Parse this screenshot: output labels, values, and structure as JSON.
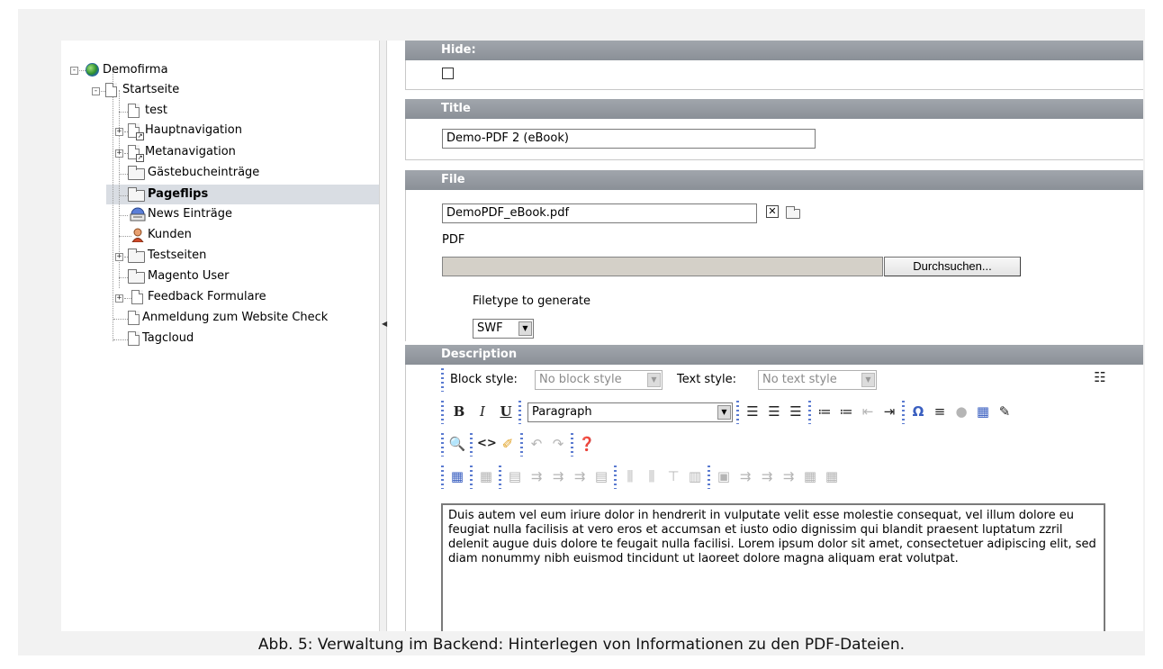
{
  "tree": {
    "root": "Demofirma",
    "items": [
      {
        "label": "Startseite"
      },
      {
        "label": "test"
      },
      {
        "label": "Hauptnavigation"
      },
      {
        "label": "Metanavigation"
      },
      {
        "label": "Gästebucheinträge"
      },
      {
        "label": "Pageflips"
      },
      {
        "label": "News Einträge"
      },
      {
        "label": "Kunden"
      },
      {
        "label": "Testseiten"
      },
      {
        "label": "Magento User"
      },
      {
        "label": "Feedback Formulare"
      },
      {
        "label": "Anmeldung zum Website Check"
      },
      {
        "label": "Tagcloud"
      }
    ],
    "expand_symbol": "+",
    "collapse_symbol": "-"
  },
  "form": {
    "hide": {
      "label": "Hide:",
      "checked": false
    },
    "title": {
      "label": "Title",
      "value": "Demo-PDF 2 (eBook)"
    },
    "file": {
      "label": "File",
      "value": "DemoPDF_eBook.pdf",
      "pdf_label": "PDF",
      "browse_label": "Durchsuchen...",
      "filetype_label": "Filetype to generate",
      "filetype_value": "SWF"
    },
    "description": {
      "label": "Description",
      "block_style_label": "Block style:",
      "block_style_value": "No block style",
      "text_style_label": "Text style:",
      "text_style_value": "No text style",
      "paragraph_value": "Paragraph",
      "text": "Duis autem vel eum iriure dolor in hendrerit in vulputate velit esse molestie consequat, vel illum dolore eu feugiat nulla facilisis at vero eros et accumsan et iusto odio dignissim qui blandit praesent luptatum zzril delenit augue duis dolore te feugait nulla facilisi. Lorem ipsum dolor sit amet, consectetuer adipiscing elit, sed diam nonummy nibh euismod tincidunt ut laoreet dolore magna aliquam erat volutpat."
    }
  },
  "toolbar": {
    "bold": "B",
    "italic": "I",
    "underline": "U"
  },
  "caption": "Abb. 5: Verwaltung im Backend: Hinterlegen von Informationen zu den PDF-Dateien.",
  "colors": {
    "header_bar": "#8f959c",
    "selection": "#d9dde3",
    "accent": "#3a5fc0"
  },
  "icons": [
    "globe-icon",
    "page-icon",
    "folder-icon",
    "news-icon",
    "user-icon",
    "search-icon",
    "undo-icon",
    "redo-icon",
    "help-icon",
    "table-icon",
    "omega-icon"
  ]
}
